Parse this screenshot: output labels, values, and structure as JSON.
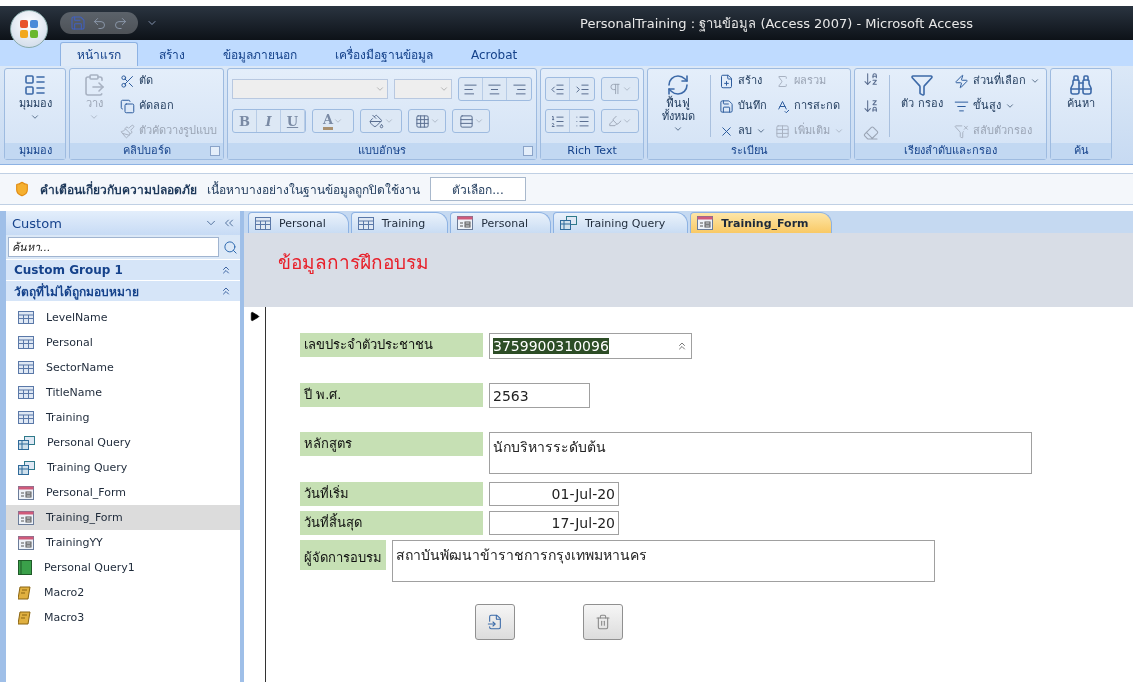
{
  "window": {
    "title": "PersonalTraining : ฐานข้อมูล (Access 2007) - Microsoft Access"
  },
  "ribbon_tabs": [
    {
      "label": "หน้าแรก",
      "selected": true
    },
    {
      "label": "สร้าง",
      "selected": false
    },
    {
      "label": "ข้อมูลภายนอก",
      "selected": false
    },
    {
      "label": "เครื่องมือฐานข้อมูล",
      "selected": false
    },
    {
      "label": "Acrobat",
      "selected": false
    }
  ],
  "ribbon_groups": [
    {
      "kind": "view",
      "label": "มุมมอง",
      "items": [
        {
          "kind": "large",
          "label": "มุมมอง",
          "disabled": false,
          "menu": true
        }
      ]
    },
    {
      "kind": "clipboard",
      "label": "คลิปบอร์ด",
      "launcher": true,
      "items": [
        {
          "kind": "large",
          "label": "วาง",
          "disabled": true,
          "menu": true
        },
        {
          "kind": "small",
          "label": "ตัด",
          "disabled": false
        },
        {
          "kind": "small",
          "label": "คัดลอก",
          "disabled": false
        },
        {
          "kind": "small",
          "label": "ตัวคัดวางรูปแบบ",
          "disabled": true
        }
      ]
    },
    {
      "kind": "font",
      "label": "แบบอักษร",
      "launcher": true,
      "format_buttons": [
        "B",
        "I",
        "U"
      ],
      "font_color_letter": "A"
    },
    {
      "kind": "richtext",
      "label": "Rich Text"
    },
    {
      "kind": "records",
      "label": "ระเบียน",
      "items": [
        {
          "kind": "large",
          "label": "ฟื้นฟู ทั้งหมด",
          "disabled": false,
          "menu": true
        },
        {
          "kind": "small",
          "label": "สร้าง",
          "disabled": false
        },
        {
          "kind": "small",
          "label": "บันทึก",
          "disabled": false
        },
        {
          "kind": "small",
          "label": "ลบ",
          "disabled": false,
          "menu": true
        },
        {
          "kind": "small",
          "label": "ผลรวม",
          "disabled": true
        },
        {
          "kind": "small",
          "label": "การสะกด",
          "disabled": false
        },
        {
          "kind": "small",
          "label": "เพิ่มเติม",
          "disabled": true,
          "menu": true
        }
      ]
    },
    {
      "kind": "sort",
      "label": "เรียงลำดับและกรอง",
      "sort_buttons": [
        {
          "disabled": false
        },
        {
          "disabled": false
        },
        {
          "disabled": true
        }
      ],
      "items": [
        {
          "kind": "large",
          "label": "ตัว กรอง",
          "disabled": false
        },
        {
          "kind": "small",
          "label": "ส่วนที่เลือก",
          "disabled": false,
          "menu": true
        },
        {
          "kind": "small",
          "label": "ขั้นสูง",
          "disabled": false,
          "menu": true
        },
        {
          "kind": "small",
          "label": "สลับตัวกรอง",
          "disabled": true
        }
      ]
    },
    {
      "kind": "find",
      "label": "ค้น",
      "items": [
        {
          "kind": "large",
          "label": "ค้นหา",
          "disabled": false
        }
      ]
    }
  ],
  "security_bar": {
    "title": "คำเตือนเกี่ยวกับความปลอดภัย",
    "message": "เนื้อหาบางอย่างในฐานข้อมูลถูกปิดใช้งาน",
    "button": "ตัวเลือก..."
  },
  "nav_pane": {
    "title": "Custom",
    "search": {
      "placeholder": "ค้นหา..."
    },
    "groups": [
      {
        "label": "Custom Group 1",
        "expanded": true
      },
      {
        "label": "วัตถุที่ไม่ได้ถูกมอบหมาย",
        "expanded": true,
        "items": [
          {
            "label": "LevelName",
            "kind": "table",
            "selected": false
          },
          {
            "label": "Personal",
            "kind": "table",
            "selected": false
          },
          {
            "label": "SectorName",
            "kind": "table",
            "selected": false
          },
          {
            "label": "TitleName",
            "kind": "table",
            "selected": false
          },
          {
            "label": "Training",
            "kind": "table",
            "selected": false
          },
          {
            "label": "Personal Query",
            "kind": "query",
            "selected": false
          },
          {
            "label": "Training Query",
            "kind": "query",
            "selected": false
          },
          {
            "label": "Personal_Form",
            "kind": "form",
            "selected": false
          },
          {
            "label": "Training_Form",
            "kind": "form",
            "selected": true
          },
          {
            "label": "TrainingYY",
            "kind": "form",
            "selected": false
          },
          {
            "label": "Personal Query1",
            "kind": "report",
            "selected": false
          },
          {
            "label": "Macro2",
            "kind": "macro",
            "selected": false
          },
          {
            "label": "Macro3",
            "kind": "macro",
            "selected": false
          }
        ]
      }
    ]
  },
  "document_tabs": [
    {
      "label": "Personal",
      "kind": "table",
      "selected": false
    },
    {
      "label": "Training",
      "kind": "table",
      "selected": false
    },
    {
      "label": "Personal",
      "kind": "form",
      "selected": false
    },
    {
      "label": "Training Query",
      "kind": "query",
      "selected": false
    },
    {
      "label": "Training_Form",
      "kind": "form",
      "selected": true
    }
  ],
  "form": {
    "title": "ข้อมูลการฝึกอบรม",
    "fields": [
      {
        "label": "เลขประจำตัวประชาชน",
        "value": "3759900310096",
        "kind": "spin",
        "highlighted": true
      },
      {
        "label": "ปี พ.ศ.",
        "value": "2563",
        "kind": "short",
        "highlighted": false
      },
      {
        "label": "หลักสูตร",
        "value": "นักบริหารระดับต้น",
        "kind": "memo",
        "highlighted": false
      },
      {
        "label": "วันที่เริ่ม",
        "value": "01-Jul-20",
        "kind": "date",
        "highlighted": false
      },
      {
        "label": "วันที่สิ้นสุด",
        "value": "17-Jul-20",
        "kind": "date",
        "highlighted": false
      },
      {
        "label": "ผู้จัดการอบรม",
        "value": "สถาบันพัฒนาข้าราชการกรุงเทพมหานคร",
        "kind": "memo",
        "highlighted": false
      }
    ]
  }
}
